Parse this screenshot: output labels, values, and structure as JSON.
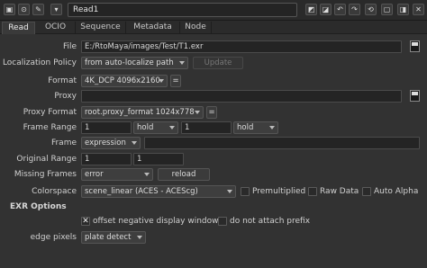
{
  "window": {
    "node_name": "Read1"
  },
  "tabs": [
    "Read",
    "OCIO",
    "Sequence",
    "Metadata",
    "Node"
  ],
  "read": {
    "file_label": "File",
    "file_value": "E:/RtoMaya/images/Test/T1.exr",
    "localization_label": "Localization Policy",
    "localization_value": "from auto-localize path",
    "update_button": "Update",
    "format_label": "Format",
    "format_value": "4K_DCP 4096x2160",
    "format_eq": "=",
    "proxy_label": "Proxy",
    "proxy_value": "",
    "proxy_format_label": "Proxy Format",
    "proxy_format_value": "root.proxy_format 1024x778",
    "proxy_format_eq": "=",
    "frame_range_label": "Frame Range",
    "frame_range_start": "1",
    "frame_range_start_mode": "hold",
    "frame_range_end": "1",
    "frame_range_end_mode": "hold",
    "frame_label": "Frame",
    "frame_mode": "expression",
    "frame_value": "",
    "original_range_label": "Original Range",
    "original_range_start": "1",
    "original_range_end": "1",
    "missing_frames_label": "Missing Frames",
    "missing_frames_value": "error",
    "reload_button": "reload",
    "colorspace_label": "Colorspace",
    "colorspace_value": "scene_linear (ACES - ACEScg)",
    "premultiplied_label": "Premultiplied",
    "raw_data_label": "Raw Data",
    "auto_alpha_label": "Auto Alpha"
  },
  "exr": {
    "section_title": "EXR Options",
    "offset_negative_label": "offset negative display window",
    "offset_negative_checked": true,
    "no_attach_prefix_label": "do not attach prefix",
    "edge_pixels_label": "edge pixels",
    "edge_pixels_value": "plate detect"
  },
  "colors": {
    "background": "#323232",
    "field": "#242424",
    "accent": "#e6a21c"
  }
}
